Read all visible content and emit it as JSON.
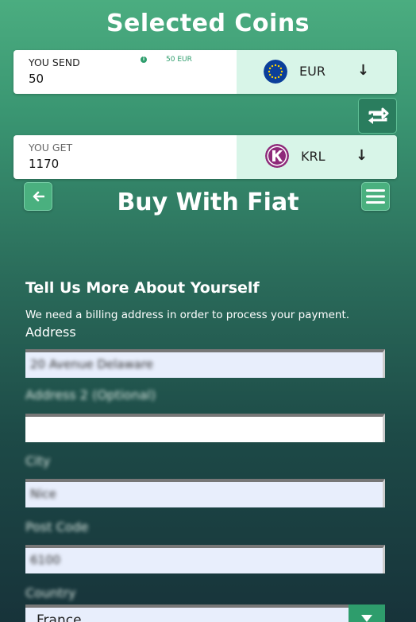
{
  "header": {
    "title": "Selected Coins"
  },
  "send": {
    "label": "YOU SEND",
    "value": "50",
    "equivalent": "50 EUR",
    "coin": "EUR",
    "coin_icon": "eu-flag-icon"
  },
  "get": {
    "label": "YOU GET",
    "value": "1170",
    "coin": "KRL",
    "coin_icon": "kryll-logo-icon"
  },
  "page": {
    "title": "Buy With Fiat"
  },
  "form": {
    "section_title": "Tell Us More About Yourself",
    "section_desc": "We need a billing address in order to process your payment.",
    "address_label": "Address",
    "address_value": "20 Avenue Delaware",
    "address2_label": "Address 2 (Optional)",
    "address2_value": "",
    "city_label": "City",
    "city_value": "Nice",
    "postcode_label": "Post Code",
    "postcode_value": "6100",
    "country_label": "Country",
    "country_value": "France"
  },
  "colors": {
    "accent": "#2e9d6c",
    "coin_panel": "#d8f5e8",
    "eur_blue": "#0b3f9a",
    "krl_purple": "#8e2a7a"
  }
}
